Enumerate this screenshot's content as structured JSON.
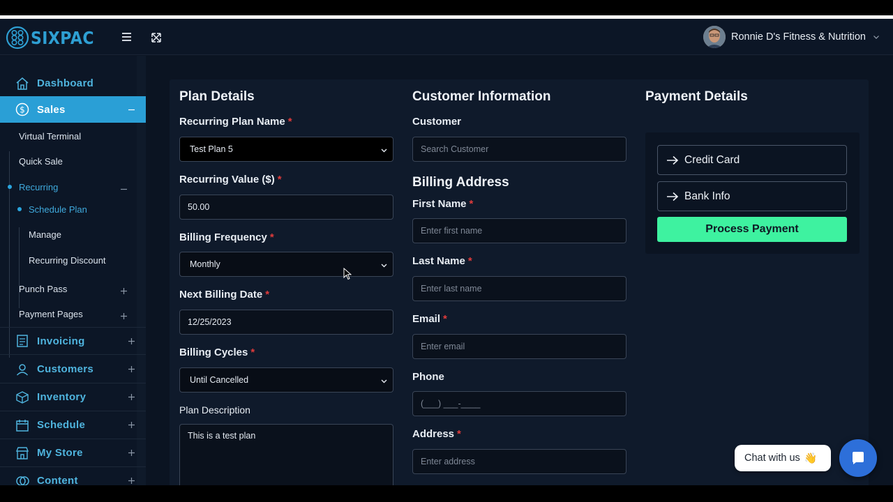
{
  "brand": {
    "name": "SIXPAC",
    "color": "#2e9fd3"
  },
  "header": {
    "user_name": "Ronnie D's Fitness & Nutrition"
  },
  "sidebar": {
    "items": [
      {
        "label": "Dashboard",
        "icon": "home-icon"
      },
      {
        "label": "Sales",
        "icon": "dollar-circle-icon",
        "active": true
      },
      {
        "label": "Invoicing",
        "icon": "invoice-icon"
      },
      {
        "label": "Customers",
        "icon": "user-icon"
      },
      {
        "label": "Inventory",
        "icon": "box-icon"
      },
      {
        "label": "Schedule",
        "icon": "calendar-icon"
      },
      {
        "label": "My Store",
        "icon": "store-icon"
      },
      {
        "label": "Content",
        "icon": "content-icon"
      }
    ],
    "sales_sub": {
      "virtual_terminal": "Virtual Terminal",
      "quick_sale": "Quick Sale",
      "recurring": "Recurring",
      "schedule_plan": "Schedule Plan",
      "manage": "Manage",
      "recurring_discount": "Recurring Discount",
      "punch_pass": "Punch Pass",
      "payment_pages": "Payment Pages"
    }
  },
  "plan": {
    "title": "Plan Details",
    "plan_name_label": "Recurring Plan Name",
    "plan_name_value": "Test Plan 5",
    "value_label": "Recurring Value ($)",
    "value_value": "50.00",
    "frequency_label": "Billing Frequency",
    "frequency_value": "Monthly",
    "next_date_label": "Next Billing Date",
    "next_date_value": "12/25/2023",
    "cycles_label": "Billing Cycles",
    "cycles_value": "Until Cancelled",
    "description_label": "Plan Description",
    "description_value": "This is a test plan"
  },
  "customer": {
    "title": "Customer Information",
    "customer_label": "Customer",
    "customer_placeholder": "Search Customer",
    "billing_title": "Billing Address",
    "first_name_label": "First Name",
    "first_name_placeholder": "Enter first name",
    "last_name_label": "Last Name",
    "last_name_placeholder": "Enter last name",
    "email_label": "Email",
    "email_placeholder": "Enter email",
    "phone_label": "Phone",
    "phone_placeholder": "(___) ___-____",
    "address_label": "Address",
    "address_placeholder": "Enter address"
  },
  "payment": {
    "title": "Payment Details",
    "credit_card": "Credit Card",
    "bank_info": "Bank Info",
    "process_button": "Process Payment",
    "accent": "#3ef2a0"
  },
  "chat": {
    "label": "Chat with us",
    "emoji": "👋"
  },
  "required_marker": "*"
}
